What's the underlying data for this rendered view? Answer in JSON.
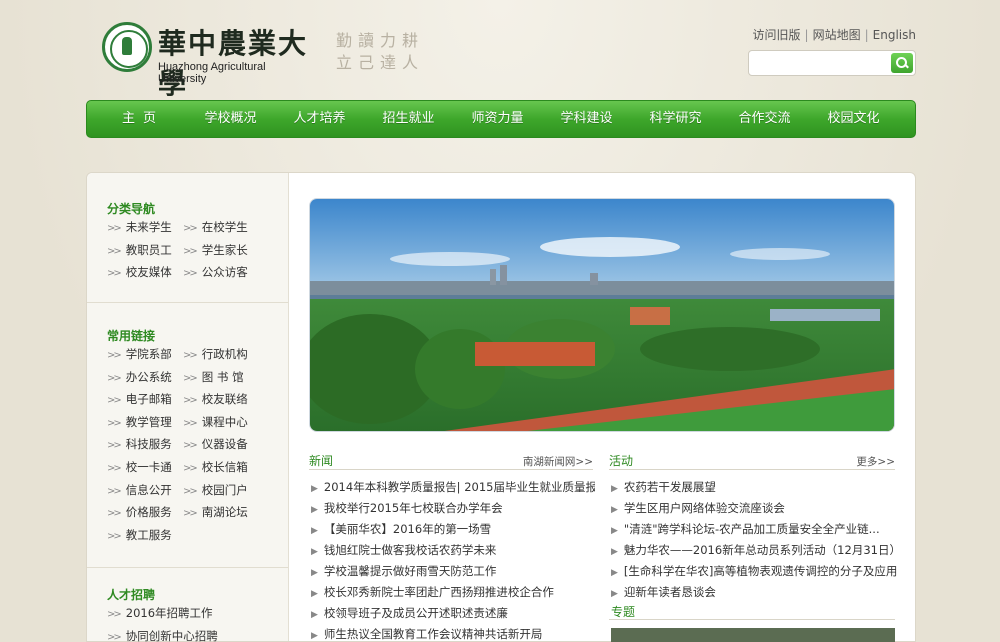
{
  "header": {
    "logo_cn": "華中農業大學",
    "logo_en": "Huazhong Agricultural University",
    "motto_line1": "勤讀力耕",
    "motto_line2": "立己達人",
    "links": [
      "访问旧版",
      "网站地图",
      "English"
    ],
    "search_placeholder": ""
  },
  "nav": [
    "主页",
    "学校概况",
    "人才培养",
    "招生就业",
    "师资力量",
    "学科建设",
    "科学研究",
    "合作交流",
    "校园文化"
  ],
  "sidebar": {
    "category_title": "分类导航",
    "category_links": [
      "未来学生",
      "在校学生",
      "教职员工",
      "学生家长",
      "校友媒体",
      "公众访客"
    ],
    "common_title": "常用链接",
    "common_links": [
      "学院系部",
      "行政机构",
      "办公系统",
      "图 书 馆",
      "电子邮箱",
      "校友联络",
      "教学管理",
      "课程中心",
      "科技服务",
      "仪器设备",
      "校一卡通",
      "校长信箱",
      "信息公开",
      "校园门户",
      "价格服务",
      "南湖论坛",
      "教工服务"
    ],
    "talent_title": "人才招聘",
    "talent_links": [
      "2016年招聘工作",
      "协同创新中心招聘"
    ]
  },
  "news": {
    "title": "新闻",
    "more": "南湖新闻网>>",
    "items": [
      "2014年本科教学质量报告| 2015届毕业生就业质量报告",
      "我校举行2015年七校联合办学年会",
      "【美丽华农】2016年的第一场雪",
      "钱旭红院士做客我校话农药学未来",
      "学校温馨提示做好雨雪天防范工作",
      "校长邓秀新院士率团赴广西扬翔推进校企合作",
      "校领导班子及成员公开述职述责述廉",
      "师生热议全国教育工作会议精神共话新开局"
    ]
  },
  "activities": {
    "title": "活动",
    "more": "更多>>",
    "items": [
      "农药若干发展展望",
      "学生区用户网络体验交流座谈会",
      "\"清涟\"跨学科论坛-农产品加工质量安全全产业链...",
      "魅力华农——2016新年总动员系列活动（12月31日）",
      "[生命科学在华农]高等植物表观遗传调控的分子及应用",
      "迎新年读者恳谈会"
    ]
  },
  "special": {
    "title": "专题"
  }
}
